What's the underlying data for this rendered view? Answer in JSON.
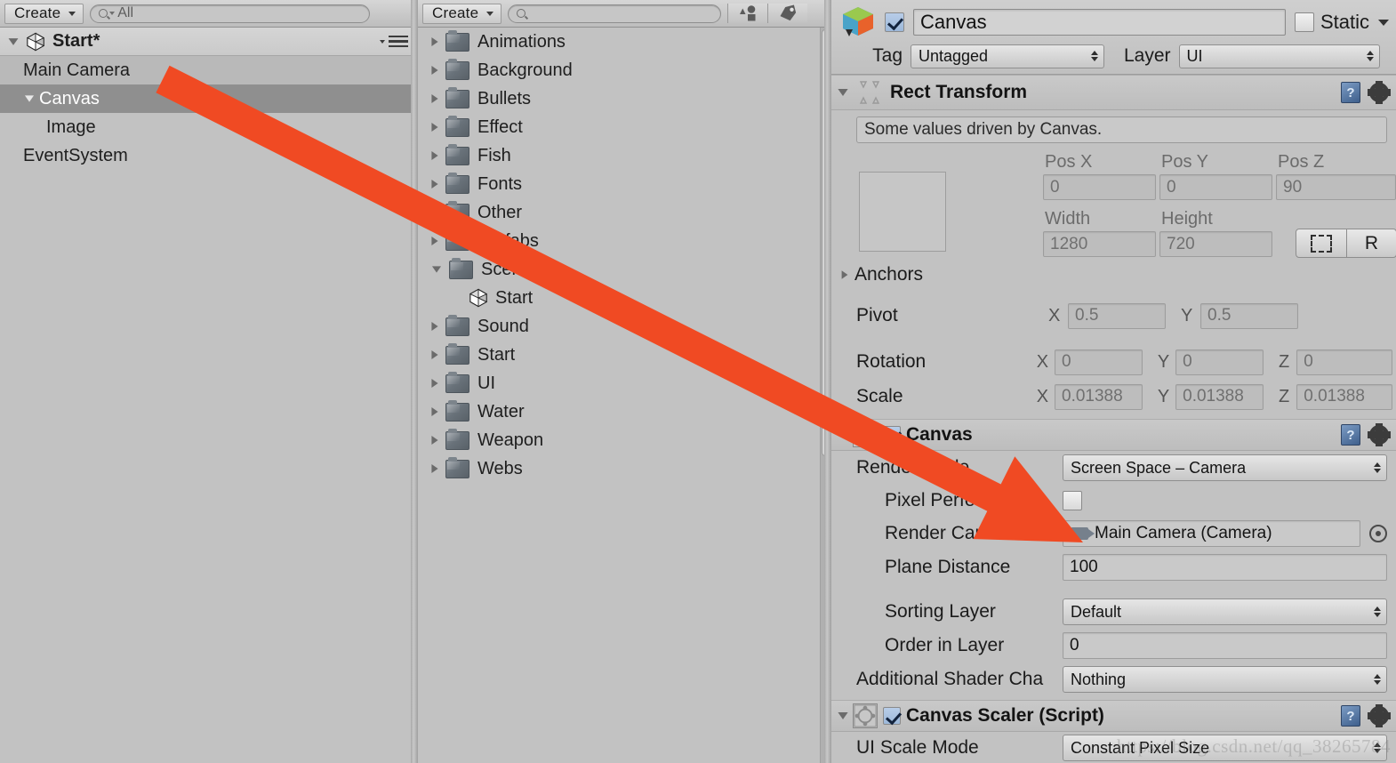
{
  "hierarchy": {
    "toolbar": {
      "create_label": "Create",
      "search_value": "All",
      "search_placeholder": "All"
    },
    "scene": {
      "name": "Start*"
    },
    "items": [
      {
        "label": "Main Camera",
        "depth": 1,
        "state": "hover",
        "expandable": false
      },
      {
        "label": "Canvas",
        "depth": 1,
        "state": "selected",
        "expandable": true
      },
      {
        "label": "Image",
        "depth": 2,
        "state": "normal",
        "expandable": false
      },
      {
        "label": "EventSystem",
        "depth": 1,
        "state": "normal",
        "expandable": false
      }
    ]
  },
  "project": {
    "toolbar": {
      "create_label": "Create",
      "search_value": "",
      "search_placeholder": ""
    },
    "items": [
      {
        "label": "Animations",
        "type": "folder",
        "expanded": false
      },
      {
        "label": "Background",
        "type": "folder",
        "expanded": false
      },
      {
        "label": "Bullets",
        "type": "folder",
        "expanded": false
      },
      {
        "label": "Effect",
        "type": "folder",
        "expanded": false
      },
      {
        "label": "Fish",
        "type": "folder",
        "expanded": false
      },
      {
        "label": "Fonts",
        "type": "folder",
        "expanded": false
      },
      {
        "label": "Other",
        "type": "folder",
        "expanded": false
      },
      {
        "label": "Prefabs",
        "type": "folder",
        "expanded": false
      },
      {
        "label": "Scences",
        "type": "folder",
        "expanded": true
      },
      {
        "label": "Start",
        "type": "scene",
        "expanded": false
      },
      {
        "label": "Sound",
        "type": "folder",
        "expanded": false
      },
      {
        "label": "Start",
        "type": "folder",
        "expanded": false
      },
      {
        "label": "UI",
        "type": "folder",
        "expanded": false
      },
      {
        "label": "Water",
        "type": "folder",
        "expanded": false
      },
      {
        "label": "Weapon",
        "type": "folder",
        "expanded": false
      },
      {
        "label": "Webs",
        "type": "folder",
        "expanded": false
      }
    ]
  },
  "inspector": {
    "object": {
      "enabled": true,
      "name": "Canvas",
      "static_label": "Static",
      "static_checked": false,
      "tag_label": "Tag",
      "tag_value": "Untagged",
      "layer_label": "Layer",
      "layer_value": "UI"
    },
    "rect_transform": {
      "title": "Rect Transform",
      "note": "Some values driven by Canvas.",
      "pos_x_label": "Pos X",
      "pos_x": "0",
      "pos_y_label": "Pos Y",
      "pos_y": "0",
      "pos_z_label": "Pos Z",
      "pos_z": "90",
      "width_label": "Width",
      "width": "1280",
      "height_label": "Height",
      "height": "720",
      "blueprint_label": "",
      "raw_label": "R",
      "anchors_label": "Anchors",
      "pivot_label": "Pivot",
      "pivot_x_axis": "X",
      "pivot_x": "0.5",
      "pivot_y_axis": "Y",
      "pivot_y": "0.5",
      "rotation_label": "Rotation",
      "rot_x_axis": "X",
      "rot_x": "0",
      "rot_y_axis": "Y",
      "rot_y": "0",
      "rot_z_axis": "Z",
      "rot_z": "0",
      "scale_label": "Scale",
      "scale_x_axis": "X",
      "scale_x": "0.01388",
      "scale_y_axis": "Y",
      "scale_y": "0.01388",
      "scale_z_axis": "Z",
      "scale_z": "0.01388"
    },
    "canvas": {
      "title": "Canvas",
      "enabled": true,
      "render_mode_label": "Render Mode",
      "render_mode_value": "Screen Space – Camera",
      "pixel_perfect_label": "Pixel Perfect",
      "pixel_perfect_checked": false,
      "render_camera_label": "Render Camera",
      "render_camera_value": "Main Camera (Camera)",
      "plane_distance_label": "Plane Distance",
      "plane_distance_value": "100",
      "sorting_layer_label": "Sorting Layer",
      "sorting_layer_value": "Default",
      "order_in_layer_label": "Order in Layer",
      "order_in_layer_value": "0",
      "additional_shader_label": "Additional Shader Cha",
      "additional_shader_value": "Nothing"
    },
    "canvas_scaler": {
      "title": "Canvas Scaler (Script)",
      "enabled": true,
      "ui_scale_mode_label": "UI Scale Mode",
      "ui_scale_mode_value": "Constant Pixel Size"
    }
  },
  "annotation": {
    "arrow_color": "#F04A23",
    "arrow_from": "Main Camera (hierarchy)",
    "arrow_to": "Render Camera field"
  },
  "watermark": "https://blog.csdn.net/qq_38265784"
}
